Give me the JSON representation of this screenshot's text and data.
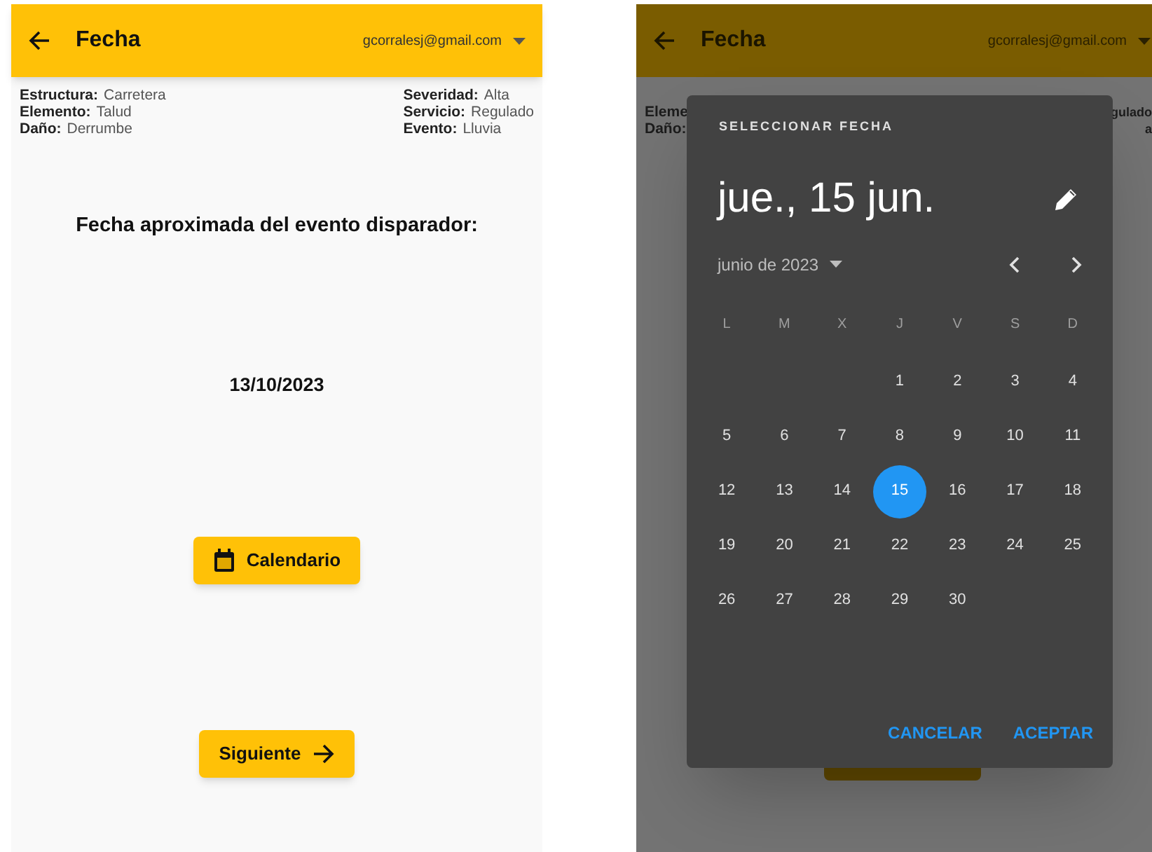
{
  "left_screen": {
    "app_bar": {
      "title": "Fecha",
      "account": "gcorralesj@gmail.com"
    },
    "details_left": [
      {
        "label": "Estructura:",
        "value": "Carretera"
      },
      {
        "label": "Elemento:",
        "value": "Talud"
      },
      {
        "label": "Daño:",
        "value": "Derrumbe"
      }
    ],
    "details_right": [
      {
        "label": "Severidad:",
        "value": "Alta"
      },
      {
        "label": "Servicio:",
        "value": "Regulado"
      },
      {
        "label": "Evento:",
        "value": "Lluvia"
      }
    ],
    "prompt": "Fecha aproximada del evento disparador:",
    "date_value": "13/10/2023",
    "calendar_button": "Calendario",
    "next_button": "Siguiente"
  },
  "right_screen": {
    "app_bar": {
      "title": "Fecha",
      "account": "gcorralesj@gmail.com"
    },
    "background_left": [
      {
        "label": "Eleme"
      },
      {
        "label": "Daño:"
      }
    ],
    "background_right": [
      {
        "label": "gulado"
      },
      {
        "label": "a"
      }
    ],
    "dialog": {
      "heading": "SELECCIONAR FECHA",
      "selected_date": "jue., 15 jun.",
      "month": "junio de 2023",
      "weekdays": [
        "L",
        "M",
        "X",
        "J",
        "V",
        "S",
        "D"
      ],
      "days": [
        {
          "kind": "blank"
        },
        {
          "kind": "blank"
        },
        {
          "kind": "blank"
        },
        {
          "kind": "day",
          "label": "1",
          "selected": false
        },
        {
          "kind": "day",
          "label": "2",
          "selected": false
        },
        {
          "kind": "day",
          "label": "3",
          "selected": false
        },
        {
          "kind": "day",
          "label": "4",
          "selected": false
        },
        {
          "kind": "day",
          "label": "5",
          "selected": false
        },
        {
          "kind": "day",
          "label": "6",
          "selected": false
        },
        {
          "kind": "day",
          "label": "7",
          "selected": false
        },
        {
          "kind": "day",
          "label": "8",
          "selected": false
        },
        {
          "kind": "day",
          "label": "9",
          "selected": false
        },
        {
          "kind": "day",
          "label": "10",
          "selected": false
        },
        {
          "kind": "day",
          "label": "11",
          "selected": false
        },
        {
          "kind": "day",
          "label": "12",
          "selected": false
        },
        {
          "kind": "day",
          "label": "13",
          "selected": false
        },
        {
          "kind": "day",
          "label": "14",
          "selected": false
        },
        {
          "kind": "day",
          "label": "15",
          "selected": true
        },
        {
          "kind": "day",
          "label": "16",
          "selected": false
        },
        {
          "kind": "day",
          "label": "17",
          "selected": false
        },
        {
          "kind": "day",
          "label": "18",
          "selected": false
        },
        {
          "kind": "day",
          "label": "19",
          "selected": false
        },
        {
          "kind": "day",
          "label": "20",
          "selected": false
        },
        {
          "kind": "day",
          "label": "21",
          "selected": false
        },
        {
          "kind": "day",
          "label": "22",
          "selected": false
        },
        {
          "kind": "day",
          "label": "23",
          "selected": false
        },
        {
          "kind": "day",
          "label": "24",
          "selected": false
        },
        {
          "kind": "day",
          "label": "25",
          "selected": false
        },
        {
          "kind": "day",
          "label": "26",
          "selected": false
        },
        {
          "kind": "day",
          "label": "27",
          "selected": false
        },
        {
          "kind": "day",
          "label": "28",
          "selected": false
        },
        {
          "kind": "day",
          "label": "29",
          "selected": false
        },
        {
          "kind": "day",
          "label": "30",
          "selected": false
        }
      ],
      "buttons": [
        "CANCELAR",
        "ACEPTAR"
      ]
    }
  }
}
